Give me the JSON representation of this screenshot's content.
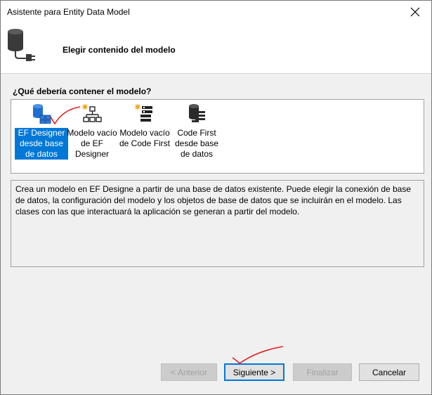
{
  "window": {
    "title": "Asistente para Entity Data Model"
  },
  "header": {
    "title": "Elegir contenido del modelo"
  },
  "section": {
    "label": "¿Qué debería contener el modelo?"
  },
  "options": [
    {
      "label": "EF Designer desde base de datos",
      "icon": "database-tables-icon",
      "selected": true
    },
    {
      "label": "Modelo vacío de EF Designer",
      "icon": "empty-diagram-icon",
      "selected": false
    },
    {
      "label": "Modelo vacío de Code First",
      "icon": "empty-code-icon",
      "selected": false
    },
    {
      "label": "Code First desde base de datos",
      "icon": "database-code-icon",
      "selected": false
    }
  ],
  "description": "Crea un modelo en EF Designe a partir de una base de datos existente. Puede elegir la conexión de base de datos, la configuración del modelo y los objetos de base de datos que se incluirán en el modelo. Las clases con las que interactuará la aplicación se generan a partir del modelo.",
  "buttons": {
    "previous": "< Anterior",
    "next": "Siguiente >",
    "finish": "Finalizar",
    "cancel": "Cancelar"
  },
  "colors": {
    "selection": "#0078d7",
    "annotation": "#e02020"
  }
}
